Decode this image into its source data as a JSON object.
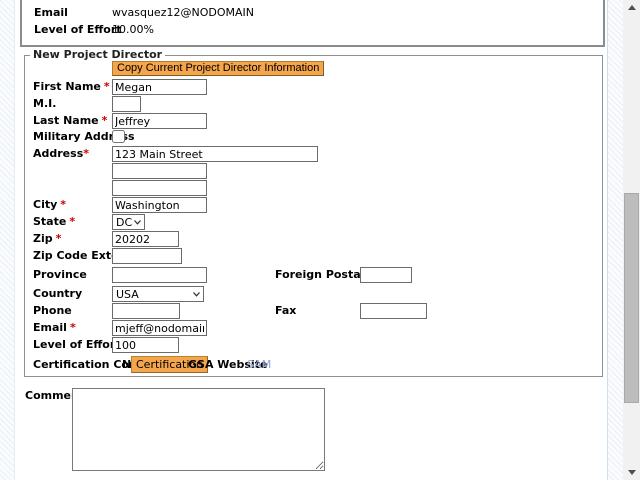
{
  "ui": {
    "required_marker": "*",
    "colors": {
      "accent_orange": "#F5A54B",
      "link_blue": "#8FA3D0",
      "required_red": "#CC0000"
    }
  },
  "current": {
    "email_label": "Email",
    "email_value": "wvasquez12@NODOMAIN",
    "loe_label": "Level of Effort",
    "loe_value": "10.00%"
  },
  "nd": {
    "legend": "New Project Director",
    "copy_button": "Copy Current Project Director Information",
    "first_name": {
      "label": "First Name",
      "value": "Megan"
    },
    "mi": {
      "label": "M.I.",
      "value": ""
    },
    "last_name": {
      "label": "Last Name",
      "value": "Jeffrey"
    },
    "military_address": {
      "label": "Military Address",
      "checked": false
    },
    "address": {
      "label": "Address",
      "line1": "123 Main Street",
      "line2": "",
      "line3": ""
    },
    "city": {
      "label": "City",
      "value": "Washington"
    },
    "state": {
      "label": "State",
      "value": "DC"
    },
    "zip": {
      "label": "Zip",
      "value": "20202"
    },
    "zip_ext": {
      "label": "Zip Code Extension",
      "value": ""
    },
    "province": {
      "label": "Province",
      "value": ""
    },
    "foreign_postal": {
      "label": "Foreign Postal Code",
      "value": ""
    },
    "country": {
      "label": "Country",
      "value": "USA"
    },
    "phone": {
      "label": "Phone",
      "value": ""
    },
    "fax": {
      "label": "Fax",
      "value": ""
    },
    "email": {
      "label": "Email",
      "value": "mjeff@nodomain"
    },
    "level_of_effort": {
      "label": "Level of Effort",
      "value": "100"
    },
    "cert": {
      "label": "Certification Complete",
      "status": "No",
      "link": "Certification",
      "gsa": "GSA Website",
      "sam": "SAM"
    }
  },
  "comments": {
    "label": "Comments",
    "value": ""
  }
}
